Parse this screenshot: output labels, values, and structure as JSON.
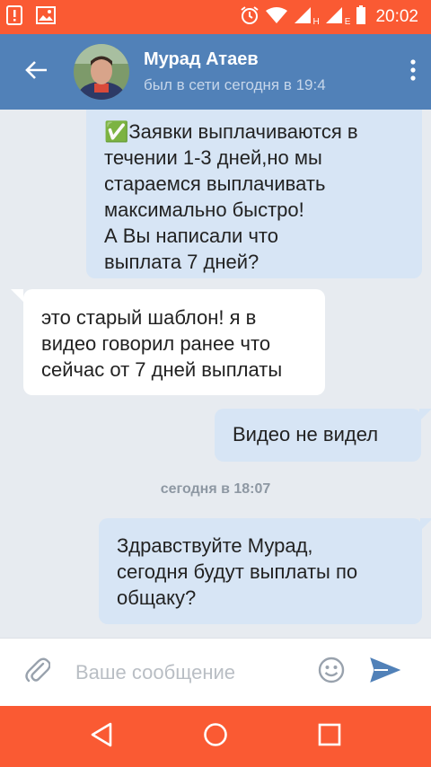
{
  "status_bar": {
    "time": "20:02",
    "network_label_1": "H",
    "network_label_2": "E"
  },
  "header": {
    "name": "Мурад Атаев",
    "status": "был в сети сегодня в 19:4"
  },
  "messages": [
    {
      "direction": "out",
      "lines": [
        "✅Заявки выплачиваются в",
        "течении 1-3 дней,но мы",
        "стараемся выплачивать",
        "максимально быстро!",
        "А Вы написали что",
        "выплата 7 дней?"
      ]
    },
    {
      "direction": "in",
      "lines": [
        "это старый шаблон! я в",
        "видео говорил ранее что",
        "сейчас от 7 дней выплаты"
      ]
    },
    {
      "direction": "out",
      "lines": [
        "Видео не видел"
      ]
    },
    {
      "direction": "out",
      "lines": [
        "Здравствуйте Мурад,",
        "сегодня будут выплаты по",
        "общаку?"
      ]
    }
  ],
  "date_separator": "сегодня в 18:07",
  "composer": {
    "placeholder": "Ваше сообщение",
    "value": ""
  },
  "colors": {
    "status_bar": "#fa5a33",
    "header": "#5181b8",
    "chat_bg": "#e7ebf0",
    "outgoing_bubble": "#d7e5f5",
    "incoming_bubble": "#ffffff",
    "send_icon": "#5181b8"
  },
  "icons": {
    "status_left": [
      "alert-icon",
      "image-icon"
    ],
    "status_right": [
      "alarm-icon",
      "wifi-icon",
      "signal-icon",
      "signal-icon",
      "battery-icon"
    ],
    "header": [
      "back-arrow-icon",
      "more-vertical-icon"
    ],
    "composer": [
      "attach-icon",
      "emoji-icon",
      "send-icon"
    ],
    "nav": [
      "back-triangle-icon",
      "home-circle-icon",
      "recents-square-icon"
    ]
  }
}
